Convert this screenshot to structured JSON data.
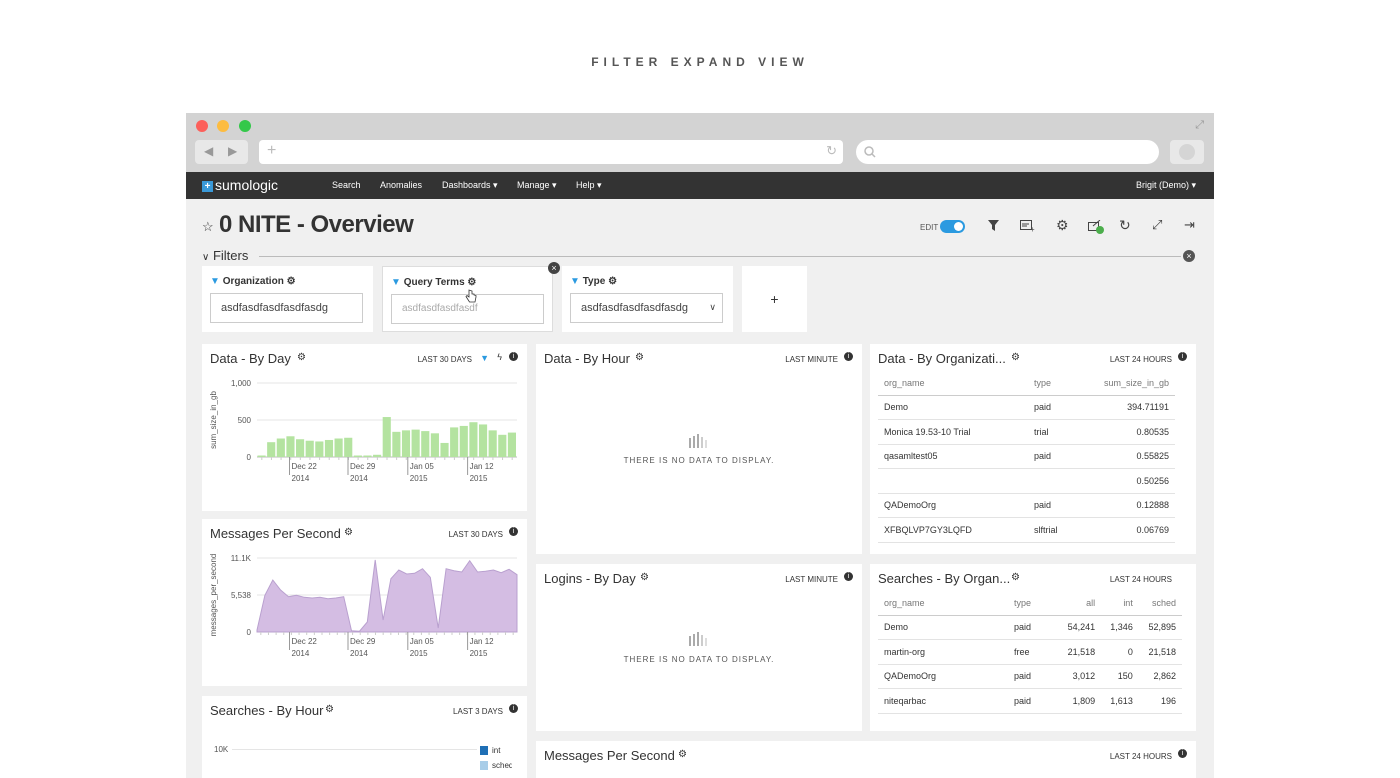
{
  "caption": "FILTER EXPAND VIEW",
  "app": {
    "logo_plus": "+",
    "logo_text": "sumologic",
    "nav": [
      "Search",
      "Anomalies",
      "Dashboards ▾",
      "Manage ▾",
      "Help ▾"
    ],
    "user": "Brigit (Demo) ▾"
  },
  "dashboard": {
    "title": "0 NITE - Overview",
    "edit_label": "EDIT",
    "filters_label": "Filters"
  },
  "filters": [
    {
      "label": "Organization",
      "value": "asdfasdfasdfasdfasdg",
      "placeholder": ""
    },
    {
      "label": "Query Terms",
      "value": "",
      "placeholder": "asdfasdfasdfasdf"
    },
    {
      "label": "Type",
      "value": "asdfasdfasdfasdfasdg",
      "placeholder": ""
    }
  ],
  "add_filter": "+",
  "panels": {
    "data_by_day": {
      "title": "Data - By Day",
      "range": "LAST 30 DAYS"
    },
    "data_by_hour": {
      "title": "Data - By Hour",
      "range": "LAST MINUTE",
      "empty": "THERE IS NO DATA TO DISPLAY."
    },
    "data_by_org": {
      "title": "Data - By Organizati...",
      "range": "LAST 24 HOURS"
    },
    "msgs_per_sec": {
      "title": "Messages Per Second",
      "range": "LAST 30 DAYS"
    },
    "logins_by_day": {
      "title": "Logins - By Day",
      "range": "LAST MINUTE",
      "empty": "THERE IS NO DATA TO DISPLAY."
    },
    "searches_by_org": {
      "title": "Searches - By Organ...",
      "range": "LAST 24 HOURS"
    },
    "searches_by_hour": {
      "title": "Searches - By Hour",
      "range": "LAST 3 DAYS"
    },
    "msgs_per_sec2": {
      "title": "Messages Per Second",
      "range": "LAST 24 HOURS"
    }
  },
  "org_table": {
    "columns": [
      "org_name",
      "type",
      "sum_size_in_gb"
    ],
    "rows": [
      [
        "Demo",
        "paid",
        "394.71191"
      ],
      [
        "Monica 19.53-10 Trial",
        "trial",
        "0.80535"
      ],
      [
        "qasamltest05",
        "paid",
        "0.55825"
      ],
      [
        "",
        "",
        "0.50256"
      ],
      [
        "QADemoOrg",
        "paid",
        "0.12888"
      ],
      [
        "XFBQLVP7GY3LQFD",
        "slftrial",
        "0.06769"
      ]
    ]
  },
  "search_org_table": {
    "columns": [
      "org_name",
      "type",
      "all",
      "int",
      "sched"
    ],
    "rows": [
      [
        "Demo",
        "paid",
        "54,241",
        "1,346",
        "52,895"
      ],
      [
        "martin-org",
        "free",
        "21,518",
        "0",
        "21,518"
      ],
      [
        "QADemoOrg",
        "paid",
        "3,012",
        "150",
        "2,862"
      ],
      [
        "niteqarbac",
        "paid",
        "1,809",
        "1,613",
        "196"
      ]
    ]
  },
  "chart_data": [
    {
      "type": "bar",
      "ylabel": "sum_size_in_gb",
      "xlabel": "",
      "ylim": [
        0,
        1000
      ],
      "yticks": [
        "1,000",
        "500",
        "0"
      ],
      "x_ticks": [
        "Dec 22\n2014",
        "Dec 29\n2014",
        "Jan 05\n2015",
        "Jan 12\n2015"
      ],
      "color": "#b4e3a0",
      "values": [
        20,
        200,
        250,
        280,
        240,
        220,
        210,
        230,
        250,
        260,
        20,
        20,
        30,
        540,
        340,
        360,
        370,
        350,
        320,
        190,
        400,
        420,
        470,
        440,
        360,
        300,
        330
      ]
    },
    {
      "type": "area",
      "ylabel": "messages_per_second",
      "xlabel": "",
      "ylim": [
        0,
        11100
      ],
      "yticks": [
        "11.1K",
        "5,538",
        "0"
      ],
      "x_ticks": [
        "Dec 22\n2014",
        "Dec 29\n2014",
        "Jan 05\n2015",
        "Jan 12\n2015"
      ],
      "color": "#d4bde3",
      "values": [
        300,
        5500,
        7800,
        6300,
        5300,
        5500,
        5200,
        5100,
        5200,
        5000,
        5100,
        5300,
        200,
        100,
        1500,
        10800,
        1800,
        8000,
        9300,
        8700,
        8800,
        9500,
        8200,
        600,
        9500,
        9200,
        9000,
        10700,
        9000,
        9100,
        9300,
        8900,
        9400,
        8600
      ]
    },
    {
      "type": "bar",
      "title": "",
      "yticks": [
        "10K"
      ],
      "series": [
        {
          "name": "int",
          "color": "#1f6fb5"
        },
        {
          "name": "sched",
          "color": "#a8cde8"
        }
      ]
    }
  ]
}
